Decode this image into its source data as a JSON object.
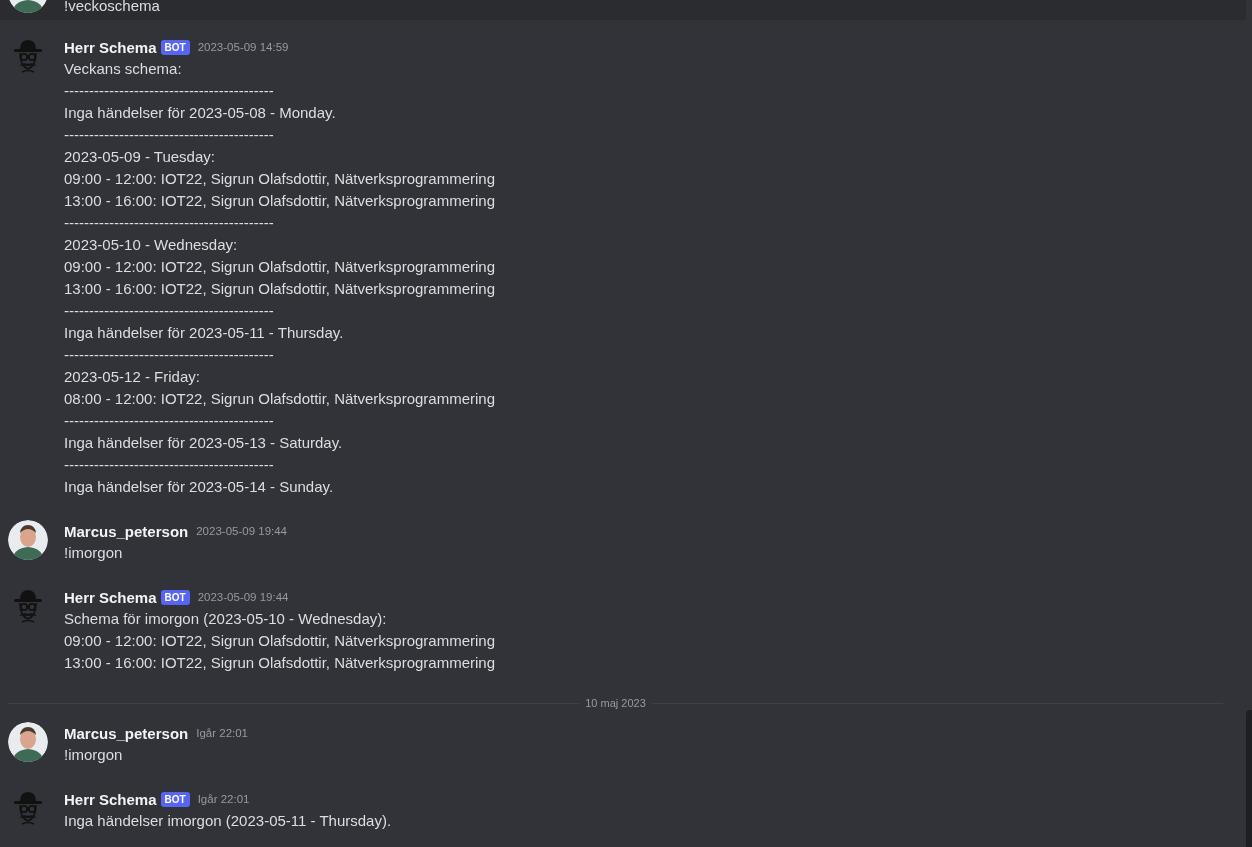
{
  "messages": [
    {
      "kind": "continued",
      "lines": [
        "!veckoschema"
      ]
    },
    {
      "kind": "message",
      "author": "Herr Schema",
      "badge": "BOT",
      "timestamp": "2023-05-09 14:59",
      "lines": [
        "Veckans schema:",
        "------------------------------------------",
        "Inga händelser för 2023-05-08 - Monday.",
        "------------------------------------------",
        "2023-05-09 - Tuesday:",
        "09:00 - 12:00: IOT22, Sigrun Olafsdottir, Nätverksprogrammering",
        "13:00 - 16:00: IOT22, Sigrun Olafsdottir, Nätverksprogrammering",
        "------------------------------------------",
        "2023-05-10 - Wednesday:",
        "09:00 - 12:00: IOT22, Sigrun Olafsdottir, Nätverksprogrammering",
        "13:00 - 16:00: IOT22, Sigrun Olafsdottir, Nätverksprogrammering",
        "------------------------------------------",
        "Inga händelser för 2023-05-11 - Thursday.",
        "------------------------------------------",
        "2023-05-12 - Friday:",
        "08:00 - 12:00: IOT22, Sigrun Olafsdottir, Nätverksprogrammering",
        "------------------------------------------",
        "Inga händelser för 2023-05-13 - Saturday.",
        "------------------------------------------",
        "Inga händelser för 2023-05-14 - Sunday."
      ]
    },
    {
      "kind": "message",
      "author": "Marcus_peterson",
      "timestamp": "2023-05-09 19:44",
      "lines": [
        "!imorgon"
      ]
    },
    {
      "kind": "message",
      "author": "Herr Schema",
      "badge": "BOT",
      "timestamp": "2023-05-09 19:44",
      "lines": [
        "Schema för imorgon (2023-05-10 - Wednesday):",
        "09:00 - 12:00: IOT22, Sigrun Olafsdottir, Nätverksprogrammering",
        "13:00 - 16:00: IOT22, Sigrun Olafsdottir, Nätverksprogrammering"
      ]
    },
    {
      "kind": "divider",
      "label": "10 maj 2023"
    },
    {
      "kind": "message",
      "author": "Marcus_peterson",
      "timestamp": "Igår 22:01",
      "lines": [
        "!imorgon"
      ]
    },
    {
      "kind": "message",
      "author": "Herr Schema",
      "badge": "BOT",
      "timestamp": "Igår 22:01",
      "lines": [
        "Inga händelser imorgon (2023-05-11 - Thursday)."
      ]
    }
  ]
}
